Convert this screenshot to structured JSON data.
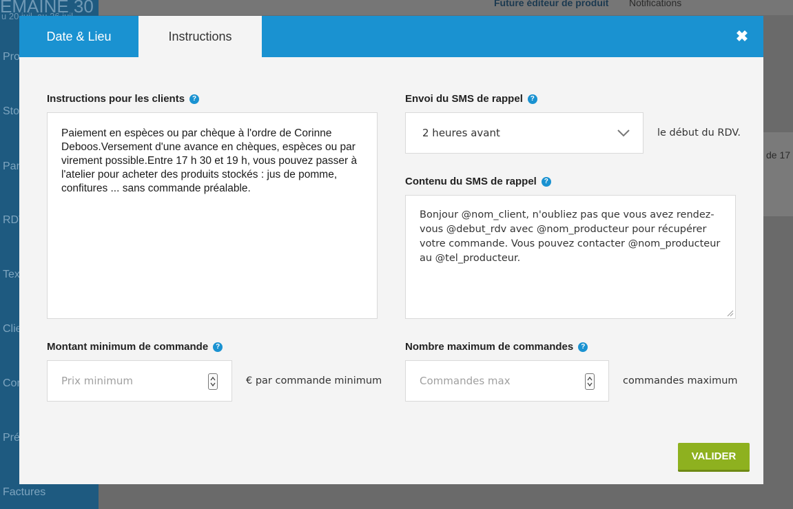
{
  "background": {
    "sidebar": {
      "week": "EMAINE 30",
      "date": "u 20 juil. au 26 juil.",
      "items": [
        "Pro",
        "Sto",
        "Pan",
        "RDV",
        "Tex",
        "Clie",
        "Com",
        "Pré",
        "Factures"
      ]
    },
    "topbar": {
      "editor": "Future éditeur de produit",
      "notifications": "Notifications"
    },
    "card_text": "de 17"
  },
  "modal": {
    "tabs": [
      "Date & Lieu",
      "Instructions"
    ],
    "close_label": "✖",
    "instructions": {
      "label": "Instructions pour les clients",
      "value": "Paiement en espèces ou par chèque à l'ordre de Corinne Deboos.Versement d'une avance en chèques, espèces ou par virement possible.Entre 17 h 30 et 19 h, vous pouvez passer à l'atelier pour acheter des produits stockés : jus de pomme, confitures ... sans commande préalable."
    },
    "sms_send": {
      "label": "Envoi du SMS de rappel",
      "selected": "2 heures avant",
      "suffix": "le début du RDV."
    },
    "sms_content": {
      "label": "Contenu du SMS de rappel",
      "value": "Bonjour @nom_client, n'oubliez pas que vous avez rendez-vous @debut_rdv avec @nom_producteur pour récupérer votre commande. Vous pouvez contacter @nom_producteur au @tel_producteur."
    },
    "min_amount": {
      "label": "Montant minimum de commande",
      "placeholder": "Prix minimum",
      "suffix": "€ par commande minimum"
    },
    "max_orders": {
      "label": "Nombre maximum de commandes",
      "placeholder": "Commandes max",
      "suffix": "commandes maximum"
    },
    "submit_label": "VALIDER",
    "help_glyph": "?"
  },
  "colors": {
    "header_blue": "#1a92d1",
    "validate_green": "#8eb11f"
  }
}
